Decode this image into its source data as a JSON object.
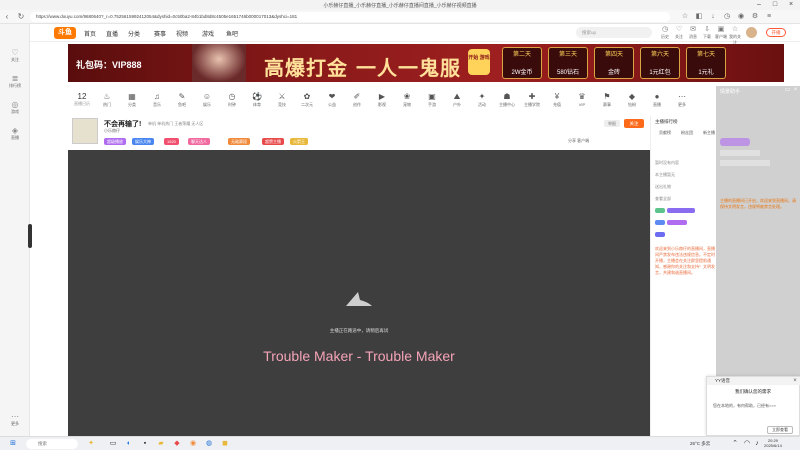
{
  "browser": {
    "title": "小乐赫仔直播_小乐赫仔直播_小乐赫仔直播间直播_小乐赫仔视频直播",
    "url": "https://www.douyu.com/9680640?_r=0.7525615992412054&dyshid=0c50ba2-84b1bd8d8c4505e1651746b000017013&dyshci=181"
  },
  "sidebar": {
    "items": [
      {
        "label": "关注"
      },
      {
        "label": "排行榜"
      },
      {
        "label": "游戏"
      },
      {
        "label": "直播"
      },
      {
        "label": "更多"
      }
    ]
  },
  "header": {
    "logo": "斗鱼",
    "nav": [
      "首页",
      "直播",
      "分类",
      "赛事",
      "视频",
      "游戏",
      "鱼吧"
    ],
    "search_placeholder": "搜索up",
    "icons": [
      "历史",
      "关注",
      "消息",
      "下载",
      "客户端",
      "我的关注",
      "任务中心"
    ],
    "start_live": "开播"
  },
  "banner": {
    "gift": "礼包码：VIP888",
    "slogan": "高爆打金 一人一鬼服",
    "btn": "开始 游戏",
    "days": [
      {
        "title": "第二天",
        "prize": "2W金币"
      },
      {
        "title": "第三天",
        "prize": "580钻石"
      },
      {
        "title": "第四天",
        "prize": "金砖"
      },
      {
        "title": "第六天",
        "prize": "1元红包"
      },
      {
        "title": "第七天",
        "prize": "1元礼"
      }
    ]
  },
  "categories": {
    "date": "12",
    "date_label": "直播日历",
    "items": [
      "热门",
      "分类",
      "音乐",
      "鱼吧",
      "娱乐",
      "时钟",
      "体育",
      "竞技",
      "二次元",
      "公益",
      "创作",
      "影视",
      "宠物",
      "手游",
      "户外",
      "活动",
      "主播中心",
      "主播学院",
      "充值",
      "VIP",
      "赛事",
      "钻粉",
      "直播",
      "更多"
    ]
  },
  "streamer": {
    "title": "不会再输了!",
    "meta": "单机  单机热门  王者荣耀  无人区",
    "name": "小乐赫仔",
    "tags": [
      "超级播放",
      "娱乐大神",
      "1520",
      "聊天达人",
      "无敌赛段",
      "超赞主播",
      "火箭王"
    ],
    "follow": "关注",
    "report": "举报",
    "actions": "分享  客户端"
  },
  "video": {
    "status": "主播正在路途中，请稍后再试",
    "song": "Trouble Maker - Trouble Maker"
  },
  "right_panel": {
    "tabs": [
      "贡献榜",
      "粉丝团",
      "新主播"
    ],
    "ranking_title": "主播排行榜",
    "notice": "欢迎来到小乐赫仔的直播间，直播间严禁发布违法违规信息。不定时开播，主播会在关注群里提前通知，感谢你的关注和支持！文明发言，共建和谐直播间。",
    "lines": [
      "暂时没有内容",
      "本主播暂无",
      "送出礼物",
      "查看全部"
    ]
  },
  "overlay": {
    "title": "情景助手",
    "text": "主播的直播间已开启，欢迎来到直播间，请保持文明发言，违规将被禁言处理。"
  },
  "popup": {
    "title": "YY语音",
    "heading": "我们确认您的需求",
    "body": "您在本地的，有何帮助，已经有>>>",
    "button": "立即查看"
  },
  "taskbar": {
    "search": "搜索",
    "weather": "26°C 多云",
    "time": "20:29",
    "date": "2025/6/14"
  },
  "colors": {
    "accent": "#ff6a1a",
    "banner": "#8b1a1a",
    "video_bg": "#3e3e3e",
    "song": "#f5a3b7"
  }
}
